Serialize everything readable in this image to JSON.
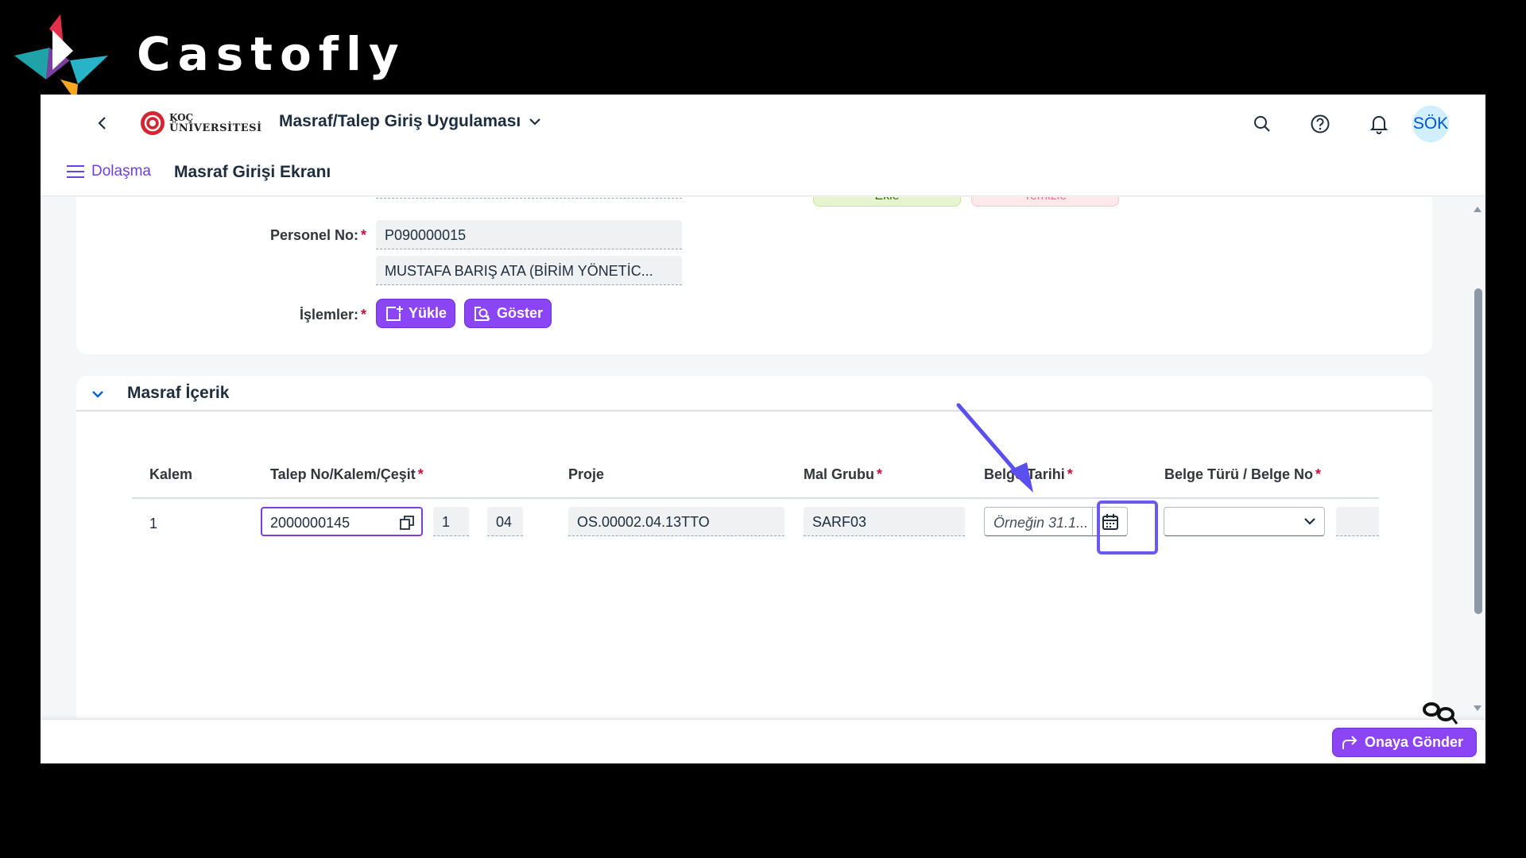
{
  "brand": {
    "name": "Castofly"
  },
  "shellbar": {
    "logo_line1": "KOÇ",
    "logo_line2": "ÜNİVERSİTESİ",
    "app_title": "Masraf/Talep Giriş Uygulaması",
    "avatar_initials": "SÖK"
  },
  "subheader": {
    "nav_label": "Dolaşma",
    "page_title": "Masraf Girişi Ekranı"
  },
  "form": {
    "partial_buttons": [
      "Ekle",
      "Temizle"
    ],
    "personnel_label": "Personel No:",
    "personnel_no": "P090000015",
    "personnel_name": "MUSTAFA BARIŞ  ATA (BİRİM YÖNETİC...",
    "operations_label": "İşlemler:",
    "upload_label": "Yükle",
    "show_label": "Göster"
  },
  "section": {
    "title": "Masraf İçerik",
    "columns": [
      "Kalem",
      "Talep No/Kalem/Çeşit",
      "Proje",
      "Mal Grubu",
      "Belge Tarihi",
      "Belge Türü / Belge No"
    ],
    "row": {
      "kalem": "1",
      "talep_no": "2000000145",
      "kalem_no": "1",
      "cesit": "04",
      "proje": "OS.00002.04.13TTO",
      "mal_grubu": "SARF03",
      "belge_tarihi_placeholder": "Örneğin 31.1...",
      "belge_turu": ""
    }
  },
  "footer": {
    "submit_label": "Onaya Gönder"
  },
  "colors": {
    "accent": "#8b45f5",
    "required": "#c0143c",
    "highlight": "#6a5bf0",
    "nav_text": "#6b40e0"
  }
}
